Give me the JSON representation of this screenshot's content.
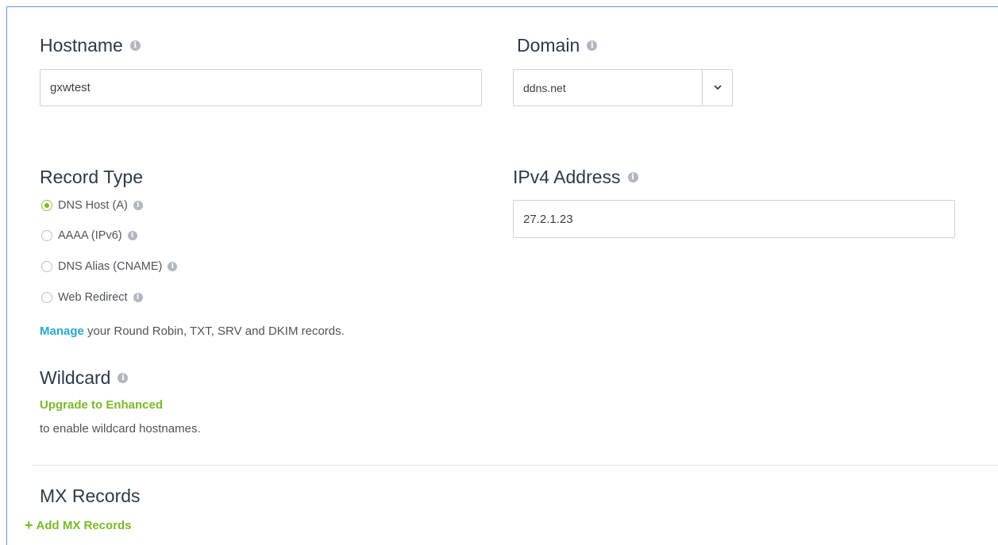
{
  "hostname": {
    "label": "Hostname",
    "value": "gxwtest"
  },
  "domain": {
    "label": "Domain",
    "value": "ddns.net"
  },
  "record_type": {
    "label": "Record Type",
    "options": [
      {
        "label": "DNS Host (A)",
        "checked": true
      },
      {
        "label": "AAAA (IPv6)",
        "checked": false
      },
      {
        "label": "DNS Alias (CNAME)",
        "checked": false
      },
      {
        "label": "Web Redirect",
        "checked": false
      }
    ],
    "manage_link": "Manage",
    "manage_text": "your Round Robin, TXT, SRV and DKIM records."
  },
  "ipv4": {
    "label": "IPv4 Address",
    "value": "27.2.1.23"
  },
  "wildcard": {
    "label": "Wildcard",
    "upgrade_link": "Upgrade to Enhanced",
    "description": "to enable wildcard hostnames."
  },
  "mx": {
    "label": "MX Records",
    "add_label": "Add MX Records"
  },
  "colors": {
    "accent_green": "#7ab929",
    "link_teal": "#29a9c9",
    "frame_blue": "#5b9bd5"
  }
}
